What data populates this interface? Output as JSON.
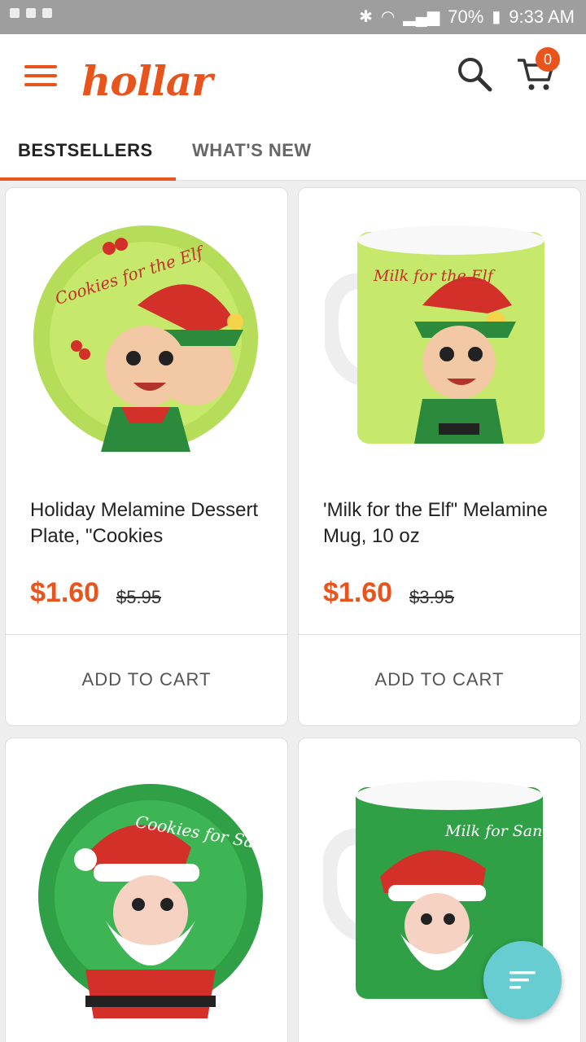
{
  "status_bar": {
    "battery": "70%",
    "time": "9:33 AM"
  },
  "header": {
    "logo": "hollar",
    "cart_count": "0"
  },
  "tabs": [
    {
      "label": "BESTSELLERS",
      "active": true
    },
    {
      "label": "WHAT'S NEW",
      "active": false
    }
  ],
  "products": [
    {
      "title": "Holiday Melamine Dessert Plate, \"Cookies",
      "price": "$1.60",
      "old_price": "$5.95",
      "add_label": "ADD TO CART",
      "image_text": "Cookies for the Elf"
    },
    {
      "title": "'Milk for the Elf\" Melamine Mug, 10 oz",
      "price": "$1.60",
      "old_price": "$3.95",
      "add_label": "ADD TO CART",
      "image_text": "Milk for the Elf"
    },
    {
      "image_text": "Cookies for Santa"
    },
    {
      "image_text": "Milk for Santa"
    }
  ],
  "colors": {
    "brand": "#e9541c",
    "fab": "#68cdd1"
  }
}
